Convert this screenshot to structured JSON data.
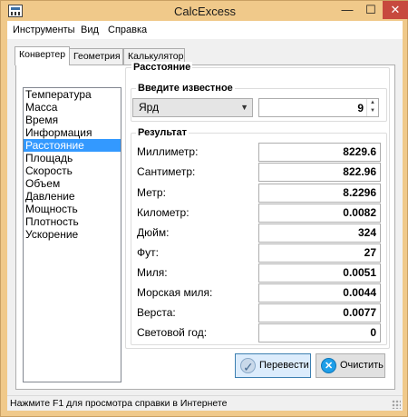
{
  "window": {
    "title": "CalcExcess",
    "minimize": "—",
    "maximize": "☐",
    "close": "✕"
  },
  "menu": [
    "Инструменты",
    "Вид",
    "Справка"
  ],
  "tabs": [
    "Конвертер",
    "Геометрия",
    "Калькулятор"
  ],
  "categories": {
    "items": [
      "Температура",
      "Масса",
      "Время",
      "Информация",
      "Расстояние",
      "Площадь",
      "Скорость",
      "Объем",
      "Давление",
      "Мощность",
      "Плотность",
      "Ускорение"
    ],
    "selected": "Расстояние"
  },
  "group_title": "Расстояние",
  "input": {
    "label": "Введите известное",
    "unit": "Ярд",
    "value": "9"
  },
  "results": {
    "label": "Результат",
    "rows": [
      {
        "label": "Миллиметр:",
        "value": "8229.6"
      },
      {
        "label": "Сантиметр:",
        "value": "822.96"
      },
      {
        "label": "Метр:",
        "value": "8.2296"
      },
      {
        "label": "Километр:",
        "value": "0.0082"
      },
      {
        "label": "Дюйм:",
        "value": "324"
      },
      {
        "label": "Фут:",
        "value": "27"
      },
      {
        "label": "Миля:",
        "value": "0.0051"
      },
      {
        "label": "Морская миля:",
        "value": "0.0044"
      },
      {
        "label": "Верста:",
        "value": "0.0077"
      },
      {
        "label": "Световой год:",
        "value": "0"
      }
    ]
  },
  "buttons": {
    "convert": "Перевести",
    "clear": "Очистить"
  },
  "status": "Нажмите F1 для просмотра справки в Интернете",
  "icons": {
    "app": "calculator-icon",
    "convert": "checkmark-icon",
    "clear": "clear-icon"
  },
  "colors": {
    "selection": "#3399ff",
    "close": "#c7493e",
    "frame": "#f0c98a"
  }
}
